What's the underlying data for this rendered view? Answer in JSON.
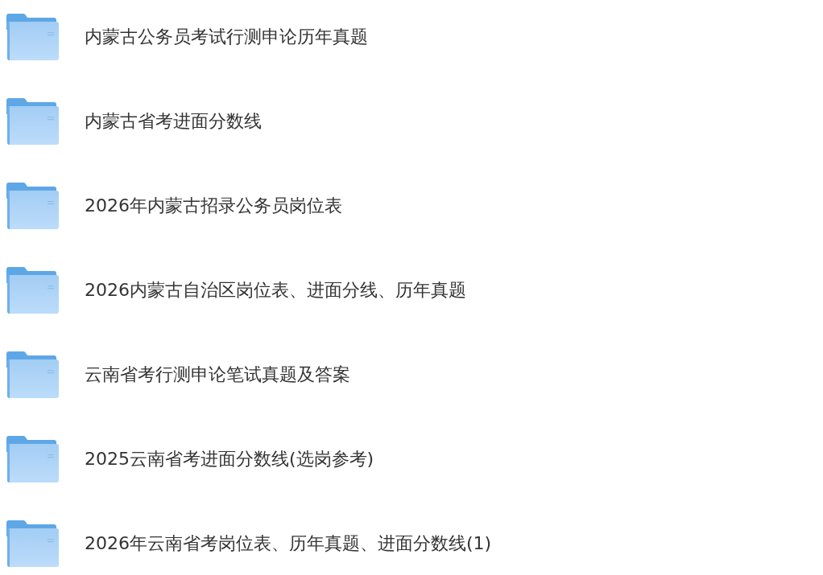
{
  "folders": [
    {
      "name": "内蒙古公务员考试行测申论历年真题"
    },
    {
      "name": "内蒙古省考进面分数线"
    },
    {
      "name": "2026年内蒙古招录公务员岗位表"
    },
    {
      "name": "2026内蒙古自治区岗位表、进面分线、历年真题"
    },
    {
      "name": "云南省考行测申论笔试真题及答案"
    },
    {
      "name": "2025云南省考进面分数线(选岗参考)"
    },
    {
      "name": "2026年云南省考岗位表、历年真题、进面分数线(1)"
    }
  ]
}
